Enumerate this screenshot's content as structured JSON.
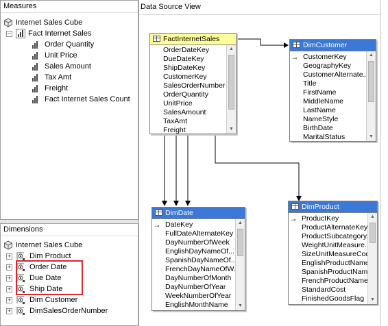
{
  "measures": {
    "header": "Measures",
    "cube": "Internet Sales Cube",
    "group": "Fact Internet Sales",
    "items": [
      "Order Quantity",
      "Unit Price",
      "Sales Amount",
      "Tax Amt",
      "Freight",
      "Fact Internet Sales Count"
    ]
  },
  "dimensions": {
    "header": "Dimensions",
    "cube": "Internet Sales Cube",
    "items": [
      "Dim Product",
      "Order Date",
      "Due Date",
      "Ship Date",
      "Dim Customer",
      "DimSalesOrderNumber"
    ]
  },
  "dsv": {
    "header": "Data Source View",
    "tables": {
      "fact": {
        "title": "FactInternetSales",
        "columns": [
          "OrderDateKey",
          "DueDateKey",
          "ShipDateKey",
          "CustomerKey",
          "SalesOrderNumber",
          "OrderQuantity",
          "UnitPrice",
          "SalesAmount",
          "TaxAmt",
          "Freight"
        ]
      },
      "customer": {
        "title": "DimCustomer",
        "columns": [
          "CustomerKey",
          "GeographyKey",
          "CustomerAlternate...",
          "Title",
          "FirstName",
          "MiddleName",
          "LastName",
          "NameStyle",
          "BirthDate",
          "MaritalStatus"
        ]
      },
      "date": {
        "title": "DimDate",
        "columns": [
          "DateKey",
          "FullDateAlternateKey",
          "DayNumberOfWeek",
          "EnglishDayNameOf...",
          "SpanishDayNameOf...",
          "FrenchDayNameOfW...",
          "DayNumberOfMonth",
          "DayNumberOfYear",
          "WeekNumberOfYear",
          "EnglishMonthName"
        ]
      },
      "product": {
        "title": "DimProduct",
        "columns": [
          "ProductKey",
          "ProductAlternateKey",
          "ProductSubcategory...",
          "WeightUnitMeasure...",
          "SizeUnitMeasureCode",
          "EnglishProductName",
          "SpanishProductName",
          "FrenchProductName",
          "StandardCost",
          "FinishedGoodsFlag"
        ]
      }
    }
  },
  "colors": {
    "title_blue": "#3b78d8",
    "title_yellow": "#ffff99",
    "highlight": "#d9262b"
  },
  "icons": {
    "cube": "cube-icon",
    "measure": "measure-bars-icon",
    "dimension": "dimension-icon",
    "table": "table-icon",
    "key": "key-icon"
  }
}
